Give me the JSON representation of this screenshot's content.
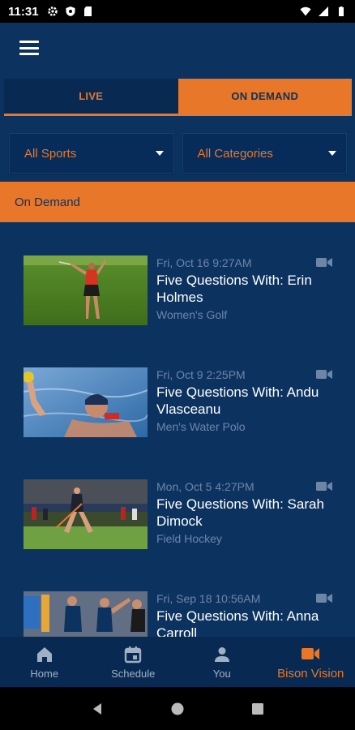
{
  "status_bar": {
    "time": "11:31"
  },
  "tabs": {
    "live": "LIVE",
    "on_demand": "ON DEMAND"
  },
  "filters": {
    "sports": "All Sports",
    "categories": "All Categories"
  },
  "section": {
    "title": "On Demand"
  },
  "videos": [
    {
      "date": "Fri, Oct 16 9:27AM",
      "title": "Five Questions With: Erin Holmes",
      "sport": "Women's Golf"
    },
    {
      "date": "Fri, Oct 9 2:25PM",
      "title": "Five Questions With: Andu Vlasceanu",
      "sport": "Men's Water Polo"
    },
    {
      "date": "Mon, Oct 5 4:27PM",
      "title": "Five Questions With: Sarah Dimock",
      "sport": "Field Hockey"
    },
    {
      "date": "Fri, Sep 18 10:56AM",
      "title": "Five Questions With: Anna Carroll",
      "sport": ""
    }
  ],
  "bottom_nav": {
    "home": "Home",
    "schedule": "Schedule",
    "you": "You",
    "bison_vision": "Bison Vision"
  },
  "colors": {
    "navy": "#0c3360",
    "orange": "#e8772a",
    "muted": "#6d86a8"
  }
}
